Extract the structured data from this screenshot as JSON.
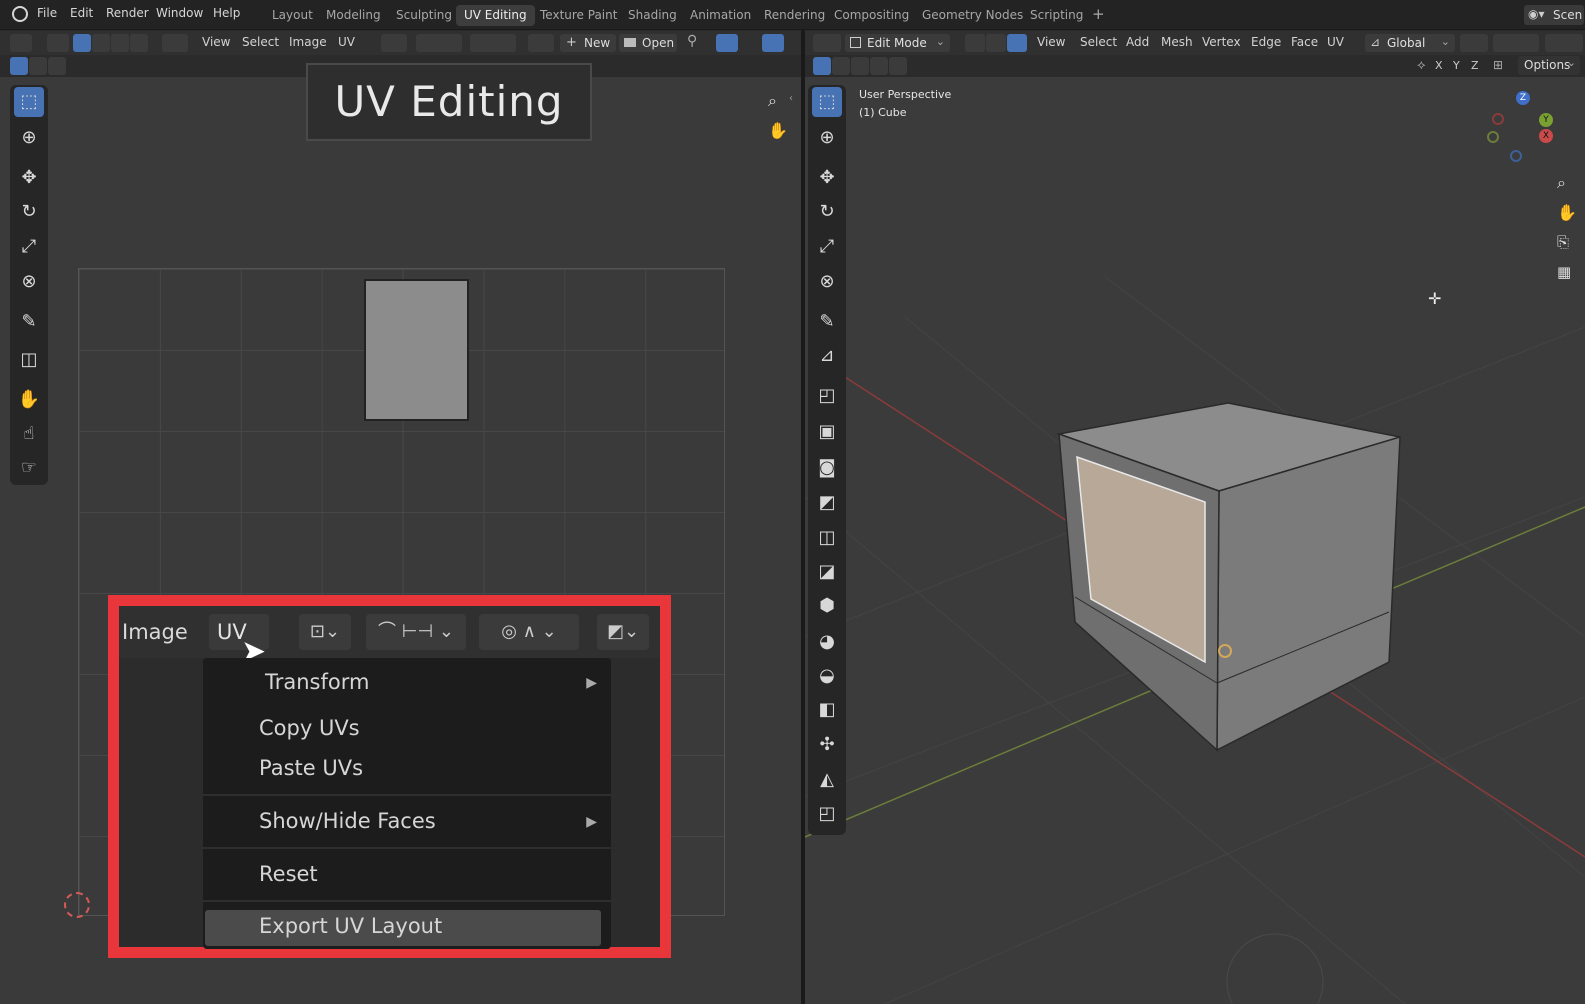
{
  "topbar": {
    "menus": [
      "File",
      "Edit",
      "Render",
      "Window",
      "Help"
    ],
    "workspaces": [
      "Layout",
      "Modeling",
      "Sculpting",
      "UV Editing",
      "Texture Paint",
      "Shading",
      "Animation",
      "Rendering",
      "Compositing",
      "Geometry Nodes",
      "Scripting"
    ],
    "active_workspace": "UV Editing",
    "scene_label": "Scen"
  },
  "uv_editor": {
    "header_menus": [
      "View",
      "Select",
      "Image",
      "UV"
    ],
    "new_label": "New",
    "open_label": "Open",
    "overlay_title": "UV Editing"
  },
  "zoomed": {
    "image_label": "Image",
    "uv_label": "UV",
    "menu": {
      "transform": "Transform",
      "copy": "Copy UVs",
      "paste": "Paste UVs",
      "showhide": "Show/Hide Faces",
      "reset": "Reset",
      "export": "Export UV Layout"
    }
  },
  "viewport": {
    "mode": "Edit Mode",
    "header_menus": [
      "View",
      "Select",
      "Add",
      "Mesh",
      "Vertex",
      "Edge",
      "Face",
      "UV"
    ],
    "orientation": "Global",
    "axes": [
      "X",
      "Y",
      "Z"
    ],
    "options_label": "Options",
    "hud_line1": "User Perspective",
    "hud_line2": "(1) Cube",
    "gizmo_labels": [
      "Z",
      "Y",
      "X"
    ]
  },
  "colors": {
    "accent": "#4772b3",
    "highlight_box": "#e8363a",
    "face_selected": "#b7a898"
  }
}
